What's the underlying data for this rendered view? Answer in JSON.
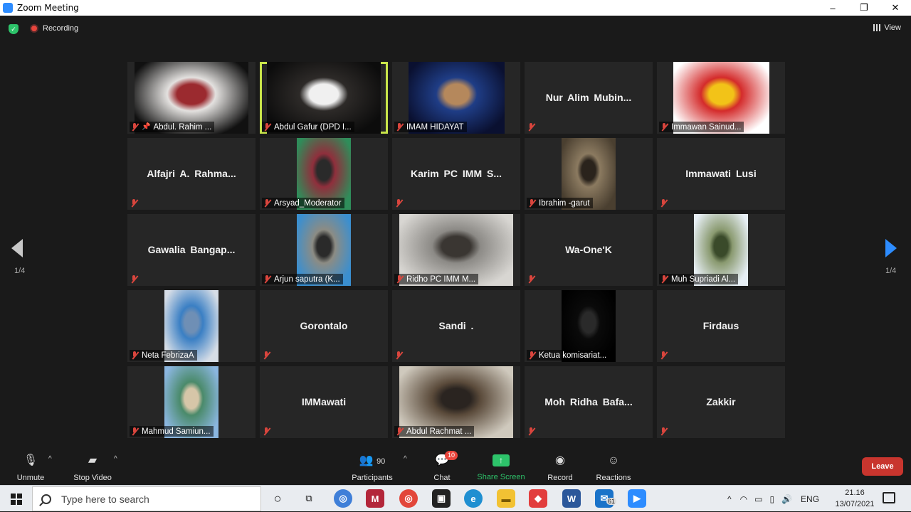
{
  "window": {
    "title": "Zoom Meeting",
    "minimize": "–",
    "restore": "❐",
    "close": "✕"
  },
  "topbar": {
    "recording_label": "Recording",
    "view_label": "View"
  },
  "pager": {
    "left_label": "1/4",
    "right_label": "1/4"
  },
  "participants": [
    {
      "name": "Abdul. Rahim ...",
      "has_video": true,
      "pinned": true,
      "colors": [
        "#111111",
        "#e3e1df",
        "#9b2a2f"
      ]
    },
    {
      "name": "Abdul Gafur (DPD I...",
      "has_video": true,
      "active": true,
      "colors": [
        "#0c0c0c",
        "#2d2a28",
        "#f0f0f0"
      ]
    },
    {
      "name": "IMAM HIDAYAT",
      "has_video": true,
      "colors": [
        "#0a1030",
        "#1f3d86",
        "#b5885c"
      ]
    },
    {
      "name": "Nur Alim Mubin...",
      "has_video": false
    },
    {
      "name": "Immawan Sainud...",
      "has_video": true,
      "colors": [
        "#ffffff",
        "#d42b2b",
        "#f2c318"
      ]
    },
    {
      "name": "Alfajri A. Rahma...",
      "has_video": false
    },
    {
      "name": "Arsyad_Moderator",
      "has_video": true,
      "colors": [
        "#2f8d5a",
        "#8f2f3c",
        "#2a2a2a"
      ]
    },
    {
      "name": "Karim PC IMM S...",
      "has_video": false
    },
    {
      "name": "Ibrahim -garut",
      "has_video": true,
      "colors": [
        "#4a3f30",
        "#8b7a60",
        "#2a231c"
      ]
    },
    {
      "name": "Immawati Lusi",
      "has_video": false
    },
    {
      "name": "Gawalia Bangap...",
      "has_video": false
    },
    {
      "name": "Arjun saputra (K...",
      "has_video": true,
      "colors": [
        "#3a8fd0",
        "#8c8c84",
        "#2a2a2a"
      ]
    },
    {
      "name": "Ridho PC IMM M...",
      "has_video": true,
      "colors": [
        "#d8d6d2",
        "#8c8a86",
        "#3a3632"
      ]
    },
    {
      "name": "Wa-One'K",
      "has_video": false
    },
    {
      "name": "Muh Supriadi Al...",
      "has_video": true,
      "colors": [
        "#e6eef4",
        "#8a9a70",
        "#3a4a2a"
      ]
    },
    {
      "name": "Neta FebrizaA",
      "has_video": true,
      "colors": [
        "#d6dde6",
        "#3a7fc4",
        "#6f8fb5"
      ]
    },
    {
      "name": "Gorontalo",
      "has_video": false
    },
    {
      "name": "Sandi .",
      "has_video": false
    },
    {
      "name": "Ketua komisariat...",
      "has_video": true,
      "colors": [
        "#000000",
        "#0a0a0a",
        "#2a2a2a"
      ]
    },
    {
      "name": "Firdaus",
      "has_video": false
    },
    {
      "name": "Mahmud Samiun...",
      "has_video": true,
      "colors": [
        "#8bb6e0",
        "#4a8a6a",
        "#d6c6a8"
      ]
    },
    {
      "name": "IMMawati",
      "has_video": false
    },
    {
      "name": "Abdul Rachmat ...",
      "has_video": true,
      "colors": [
        "#cfc9bd",
        "#5a4a3a",
        "#2a2420"
      ]
    },
    {
      "name": "Moh Ridha Bafa...",
      "has_video": false
    },
    {
      "name": "Zakkir",
      "has_video": false
    }
  ],
  "controls": {
    "unmute": "Unmute",
    "stop_video": "Stop Video",
    "participants_label": "Participants",
    "participants_count": "90",
    "chat_label": "Chat",
    "chat_badge": "10",
    "share_label": "Share Screen",
    "record_label": "Record",
    "reactions_label": "Reactions",
    "leave_label": "Leave"
  },
  "taskbar": {
    "search_placeholder": "Type here to search",
    "mail_badge": "61",
    "language": "ENG",
    "time": "21.16",
    "date": "13/07/2021"
  }
}
